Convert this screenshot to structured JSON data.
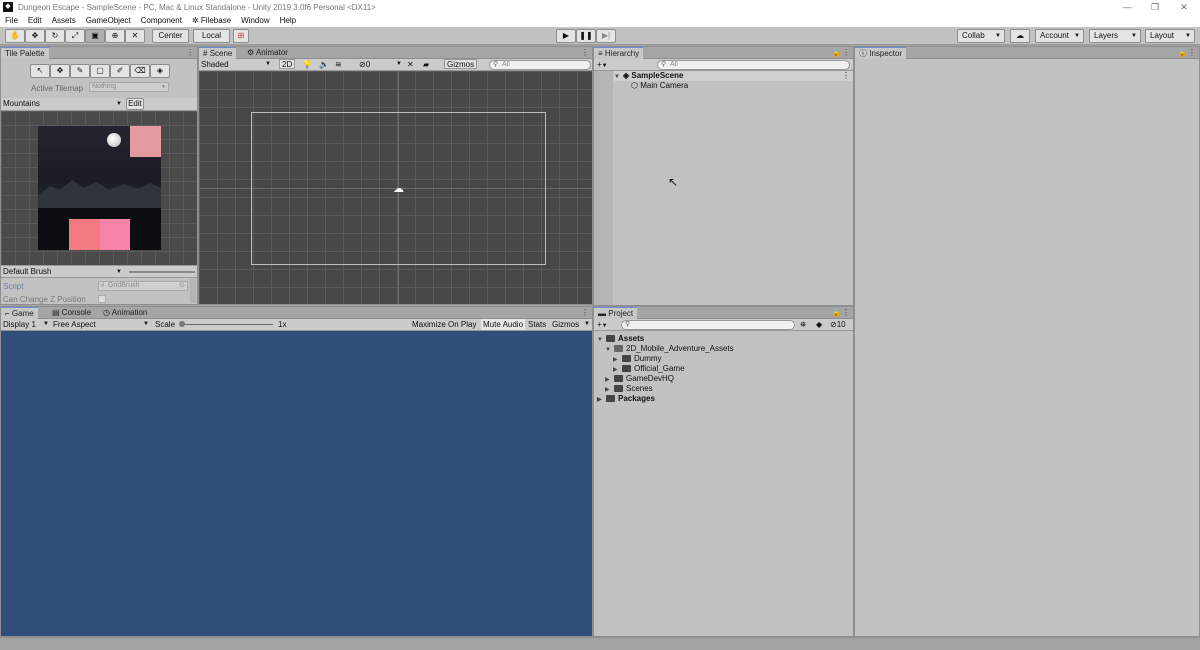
{
  "window": {
    "title": "Dungeon Escape - SampleScene - PC, Mac & Linux Standalone - Unity 2019.3.0f6 Personal <DX11>",
    "controls": [
      "—",
      "❐",
      "✕"
    ]
  },
  "menu": [
    "File",
    "Edit",
    "Assets",
    "GameObject",
    "Component",
    "Filebase",
    "Window",
    "Help"
  ],
  "toolbar": {
    "pivot_label": "Center",
    "space_label": "Local",
    "collab_label": "Collab",
    "account_label": "Account",
    "layers_label": "Layers",
    "layout_label": "Layout"
  },
  "tile_palette": {
    "tab": "Tile Palette",
    "active_tilemap_label": "Active Tilemap",
    "active_tilemap_value": "Nothing",
    "palette_name": "Mountains",
    "edit_label": "Edit",
    "brush_name": "Default Brush",
    "script_label": "Script",
    "script_value": "GridBrush",
    "z_position_label": "Can Change Z Position",
    "tile_colors": {
      "top_right": "#e39aa0",
      "bottom_left": "#f47a82",
      "bottom_right": "#f584a8"
    }
  },
  "scene": {
    "tabs": [
      "Scene",
      "Animator"
    ],
    "shading_mode": "Shaded",
    "mode_2d": "2D",
    "hidden_count": "0",
    "gizmos_label": "Gizmos",
    "search_placeholder": "All"
  },
  "hierarchy": {
    "tab": "Hierarchy",
    "search_placeholder": "All",
    "scene_name": "SampleScene",
    "items": [
      "Main Camera"
    ]
  },
  "inspector": {
    "tab": "Inspector"
  },
  "game": {
    "tabs": [
      "Game",
      "Console",
      "Animation"
    ],
    "display": "Display 1",
    "aspect": "Free Aspect",
    "scale_label": "Scale",
    "scale_value": "1x",
    "maximize_label": "Maximize On Play",
    "mute_label": "Mute Audio",
    "stats_label": "Stats",
    "gizmos_label": "Gizmos",
    "background_color": "#314d79"
  },
  "project": {
    "tab": "Project",
    "hidden_count": "10",
    "root": "Assets",
    "folders": [
      "2D_Mobile_Adventure_Assets",
      "Dummy",
      "Official_Game",
      "GameDevHQ",
      "Scenes"
    ],
    "packages": "Packages"
  }
}
